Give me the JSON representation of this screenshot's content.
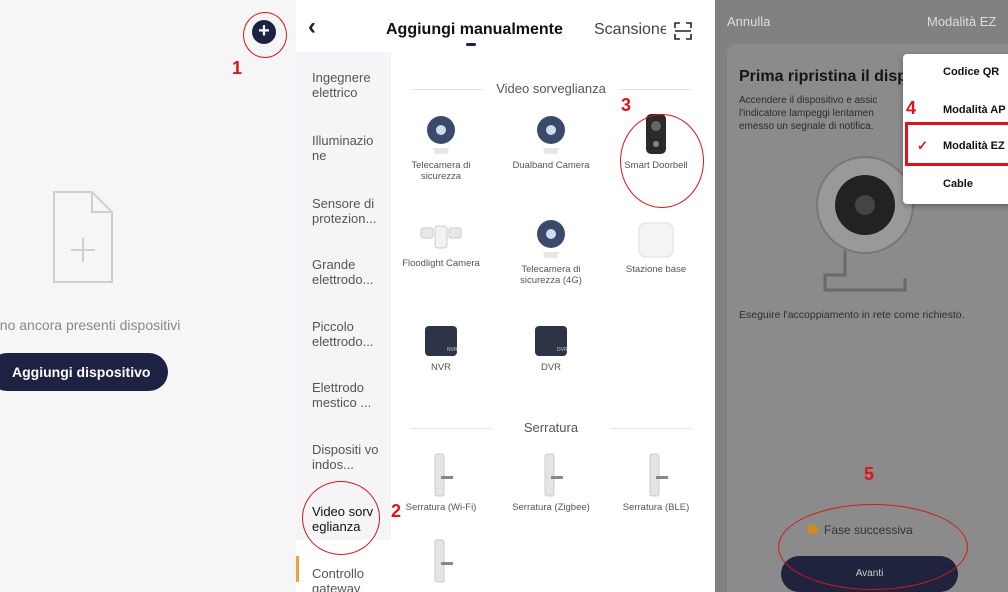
{
  "home": {
    "empty_text": "ono ancora presenti dispositivi",
    "add_device_label": "Aggiungi dispositivo"
  },
  "add_manual": {
    "tab_active": "Aggiungi manualmente",
    "tab_scan": "Scansione",
    "categories": [
      "Ingegnere elettrico",
      "Illuminazio ne",
      "Sensore di protezion...",
      "Grande elettrodo...",
      "Piccolo elettrodo...",
      "Elettrodo mestico ...",
      "Dispositi vo indos...",
      "Video sorv eglianza",
      "Controllo gateway"
    ],
    "section_video": "Video sorveglianza",
    "video_devices": [
      "Telecamera di sicurezza",
      "Dualband Camera",
      "Smart Doorbell",
      "Floodlight Camera",
      "Telecamera di sicurezza (4G)",
      "Stazione base",
      "NVR",
      "DVR"
    ],
    "nvr_tag": "NVR",
    "dvr_tag": "DVR",
    "section_lock": "Serratura",
    "lock_devices": [
      "Serratura (Wi-Fi)",
      "Serratura (Zigbee)",
      "Serratura (BLE)"
    ]
  },
  "ez_mode": {
    "cancel": "Annulla",
    "mode_label": "Modalità EZ",
    "title": "Prima ripristina il disp",
    "desc": "Accendere il dispositivo e assic l'indicatore lampeggi lentamen emesso un segnale di notifica.",
    "pair_text": "Eseguire l'accoppiamento in rete come richiesto.",
    "next_step": "Fase successiva",
    "next_button": "Avanti",
    "menu": [
      "Codice QR",
      "Modalità AP",
      "Modalità EZ",
      "Cable"
    ],
    "menu_selected": "Modalità EZ"
  },
  "annotations": [
    "1",
    "2",
    "3",
    "4",
    "5"
  ],
  "colors": {
    "navy": "#1d2142",
    "annotation_red": "#d8161b",
    "active_bar": "#f0a13b",
    "overlay_gray": "#818181"
  }
}
